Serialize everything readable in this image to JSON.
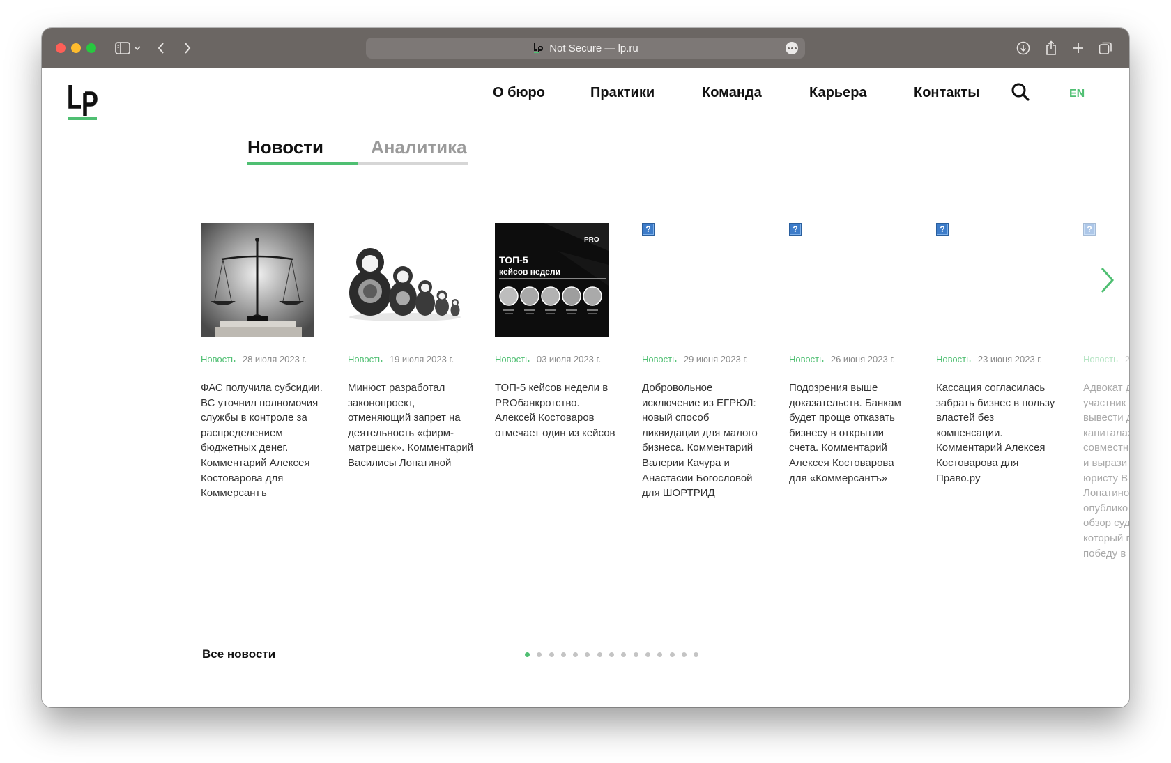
{
  "browser": {
    "url_text": "Not Secure — lp.ru"
  },
  "site": {
    "nav": [
      "О бюро",
      "Практики",
      "Команда",
      "Карьера",
      "Контакты"
    ],
    "lang": "EN",
    "tabs": [
      "Новости",
      "Аналитика"
    ],
    "active_tab_index": 0,
    "accent_color": "#4fbf72"
  },
  "cards": [
    {
      "type": "Новость",
      "date": "28 июля 2023 г.",
      "image": "scales-of-justice",
      "text": "ФАС получила субсидии. ВС уточнил полномочия службы в контроле за распределением бюджетных денег. Комментарий Алексея Костоварова для Коммерсантъ"
    },
    {
      "type": "Новость",
      "date": "19 июля 2023 г.",
      "image": "matryoshka-dolls",
      "text": "Минюст разработал законопроект, отменяющий запрет на деятельность «фирм-матрешек». Комментарий Василисы Лопатиной"
    },
    {
      "type": "Новость",
      "date": "03 июля 2023 г.",
      "image": "pro-top5-banner",
      "image_text": {
        "brand": "PRO",
        "title_line1": "ТОП-5",
        "title_line2": "кейсов недели"
      },
      "text": "ТОП-5 кейсов недели в PROбанкротство. Алексей Костоваров отмечает один из кейсов"
    },
    {
      "type": "Новость",
      "date": "29 июня 2023 г.",
      "image": "broken-image",
      "text": "Добровольное исключение из ЕГРЮЛ: новый способ ликвидации для малого бизнеса. Комментарий Валерии Качура и Анастасии Богословой для ШОРТРИД"
    },
    {
      "type": "Новость",
      "date": "26 июня 2023 г.",
      "image": "broken-image",
      "text": "Подозрения выше доказательств. Банкам будет проще отказать бизнесу в открытии счета. Комментарий Алексея Костоварова для «Коммерсантъ»"
    },
    {
      "type": "Новость",
      "date": "23 июня 2023 г.",
      "image": "broken-image",
      "text": "Кассация согласилась забрать бизнес в пользу властей без компенсации. Комментарий Алексея Костоварова для Право.ру"
    },
    {
      "type": "Новость",
      "date": "2",
      "image": "broken-image",
      "text_lines": [
        "Адвокат д",
        "участник",
        "вывести д",
        "капиталах",
        "совместн",
        "и вырази",
        "юристу В",
        "Лопатино",
        "опублико",
        "обзор суд",
        "который г",
        "победу в"
      ]
    }
  ],
  "footer": {
    "all_news": "Все новости"
  },
  "pagination": {
    "total": 15,
    "active": 0
  },
  "icons": [
    "sidebar-icon",
    "chevron-down-icon",
    "back-icon",
    "forward-icon",
    "download-icon",
    "share-icon",
    "new-tab-icon",
    "tabs-overview-icon",
    "search-icon",
    "next-arrow-icon"
  ]
}
